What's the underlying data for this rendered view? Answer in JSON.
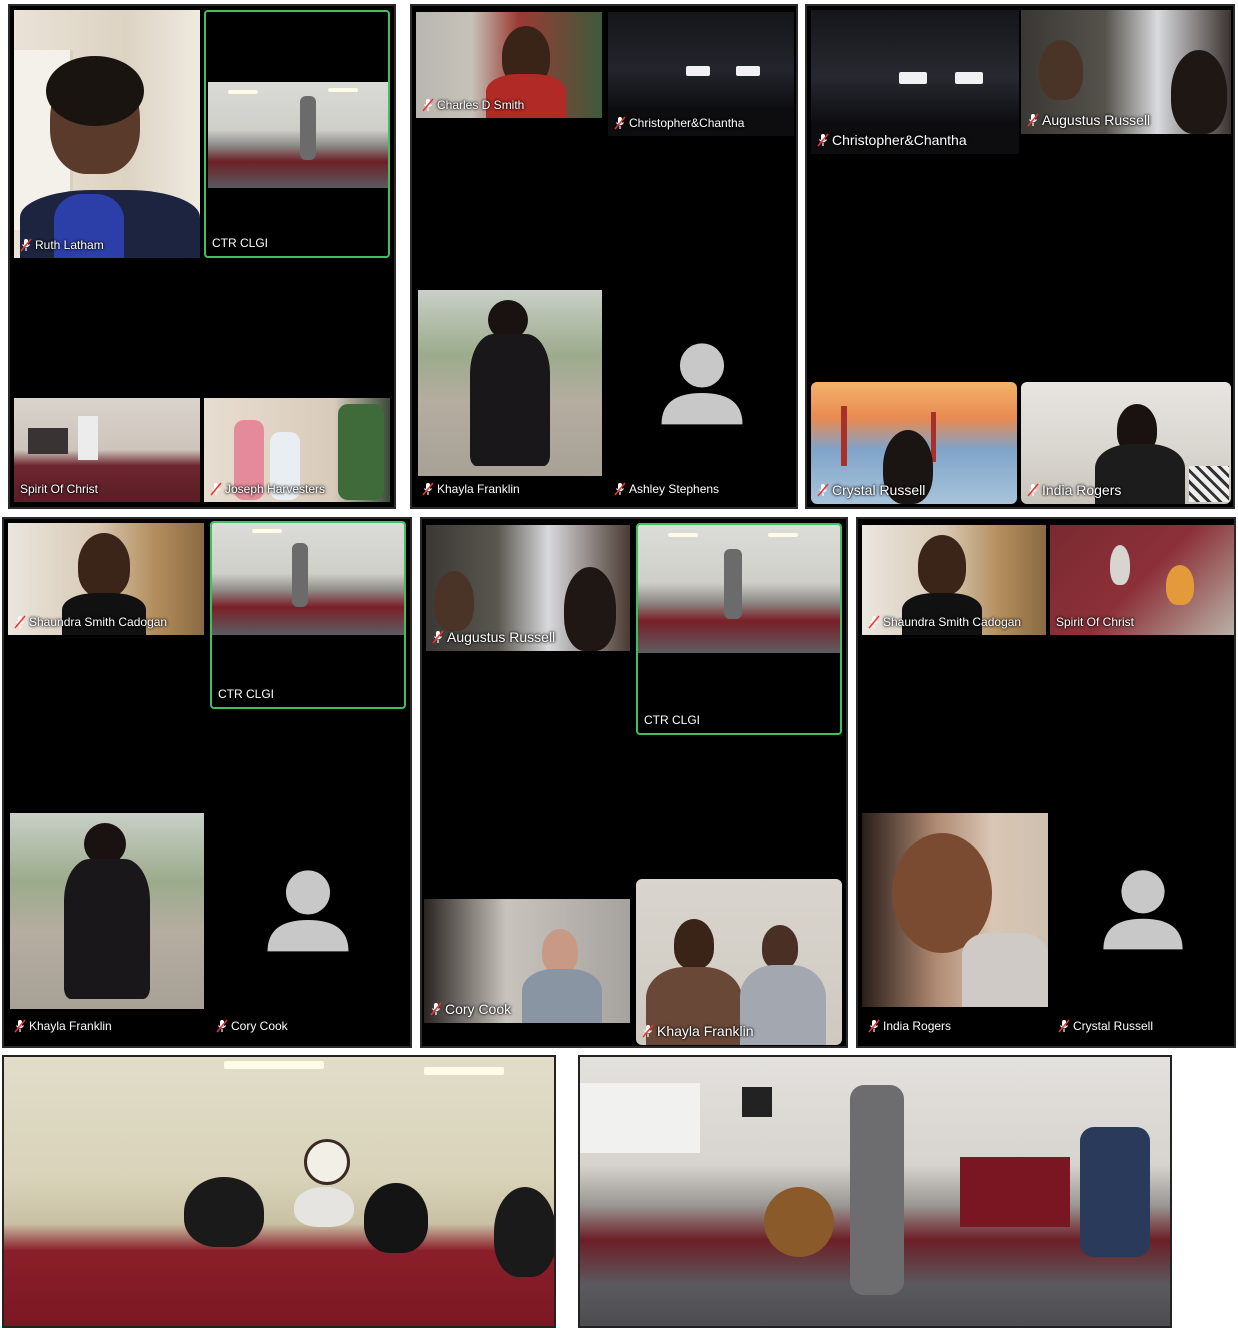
{
  "colors": {
    "active_border": "#3fbf5f",
    "panel_bg": "#000000",
    "avatar_gray": "#c8c8c8"
  },
  "icons": {
    "muted": "mic-muted-icon",
    "placeholder": "person-avatar-icon"
  },
  "panel1": {
    "ruth": "Ruth Latham",
    "ctr": "CTR CLGI",
    "spirit": "Spirit Of Christ",
    "joseph": "Joseph Harvesters"
  },
  "panel2": {
    "charles": "Charles D Smith",
    "christopher": "Christopher&Chantha",
    "khayla": "Khayla Franklin",
    "ashley": "Ashley Stephens"
  },
  "panel3": {
    "christopher": "Christopher&Chantha",
    "augustus": "Augustus Russell",
    "crystal": "Crystal Russell",
    "india": "India Rogers"
  },
  "panel4": {
    "shaundra": "Shaundra Smith Cadogan",
    "ctr": "CTR CLGI",
    "khayla": "Khayla Franklin",
    "cory": "Cory Cook"
  },
  "panel5": {
    "augustus": "Augustus Russell",
    "ctr": "CTR CLGI",
    "cory": "Cory Cook",
    "khayla": "Khayla Franklin"
  },
  "panel6": {
    "shaundra": "Shaundra Smith Cadogan",
    "spirit": "Spirit Of Christ",
    "india": "India Rogers",
    "crystal": "Crystal Russell"
  }
}
